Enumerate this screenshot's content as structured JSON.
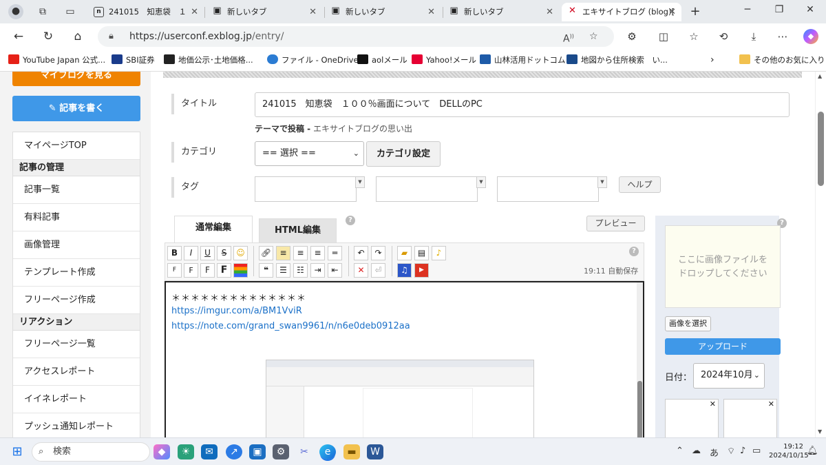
{
  "browser": {
    "tabs": [
      {
        "title": "241015　知恵袋　１",
        "favicon": "n"
      },
      {
        "title": "新しいタブ",
        "favicon": "▣"
      },
      {
        "title": "新しいタブ",
        "favicon": "▣"
      },
      {
        "title": "新しいタブ",
        "favicon": "▣"
      },
      {
        "title": "エキサイトブログ (blog)[",
        "favicon": "✕"
      }
    ],
    "url_host": "https://userconf.exblog.jp",
    "url_path": "/entry/",
    "favorites": [
      {
        "label": "YouTube Japan 公式...",
        "color": "#e62117"
      },
      {
        "label": "SBI証券",
        "color": "#1a3b8b"
      },
      {
        "label": "地価公示･土地価格...",
        "color": "#222222"
      },
      {
        "label": "ファイル - OneDrive",
        "color": "#2b7cd3"
      },
      {
        "label": "aolメール",
        "color": "#111111"
      },
      {
        "label": "Yahoo!メール",
        "color": "#e60033"
      },
      {
        "label": "山林活用ドットコム",
        "color": "#1e5ba8"
      },
      {
        "label": "地図から住所検索　い...",
        "color": "#1a4a8a"
      }
    ],
    "other_favorites": "その他のお気に入り"
  },
  "sidebar": {
    "top_button": "マイブログを見る",
    "write_button": "記事を書く",
    "top_item": "マイページTOP",
    "section_manage": "記事の管理",
    "manage_items": [
      "記事一覧",
      "有料記事",
      "画像管理",
      "テンプレート作成",
      "フリーページ作成"
    ],
    "section_reaction": "リアクション",
    "reaction_items": [
      "フリーページ一覧",
      "アクセスレポート",
      "イイネレポート",
      "プッシュ通知レポート"
    ]
  },
  "form": {
    "title_label": "タイトル",
    "title_value": "241015　知恵袋　１００％画面について　DELLのPC",
    "theme_label": "テーマで投稿 -",
    "theme_value": "エキサイトブログの思い出",
    "category_label": "カテゴリ",
    "category_select": "== 選択 ==",
    "category_button": "カテゴリ設定",
    "tag_label": "タグ",
    "help_button": "ヘルプ"
  },
  "editor": {
    "tab_normal": "通常編集",
    "tab_html": "HTML編集",
    "preview_button": "プレビュー",
    "autosave": "19:11 自動保存",
    "lines": [
      {
        "text": "＊＊＊＊＊＊＊＊＊＊＊＊＊＊",
        "link": false
      },
      {
        "text": "https://imgur.com/a/BM1VviR",
        "link": true
      },
      {
        "text": "https://note.com/grand_swan9961/n/n6e0deb0912aa",
        "link": true
      }
    ]
  },
  "upload": {
    "drop_text_1": "ここに画像ファイルを",
    "drop_text_2": "ドロップしてください",
    "choose_button": "画像を選択",
    "upload_button": "アップロード",
    "date_label": "日付：",
    "date_value": "2024年10月"
  },
  "taskbar": {
    "search_placeholder": "検索",
    "ime": "あ",
    "time": "19:12",
    "date": "2024/10/15"
  },
  "colors": {
    "orange": "#ef8300",
    "blue": "#3f98e8",
    "link": "#1a70c8"
  }
}
